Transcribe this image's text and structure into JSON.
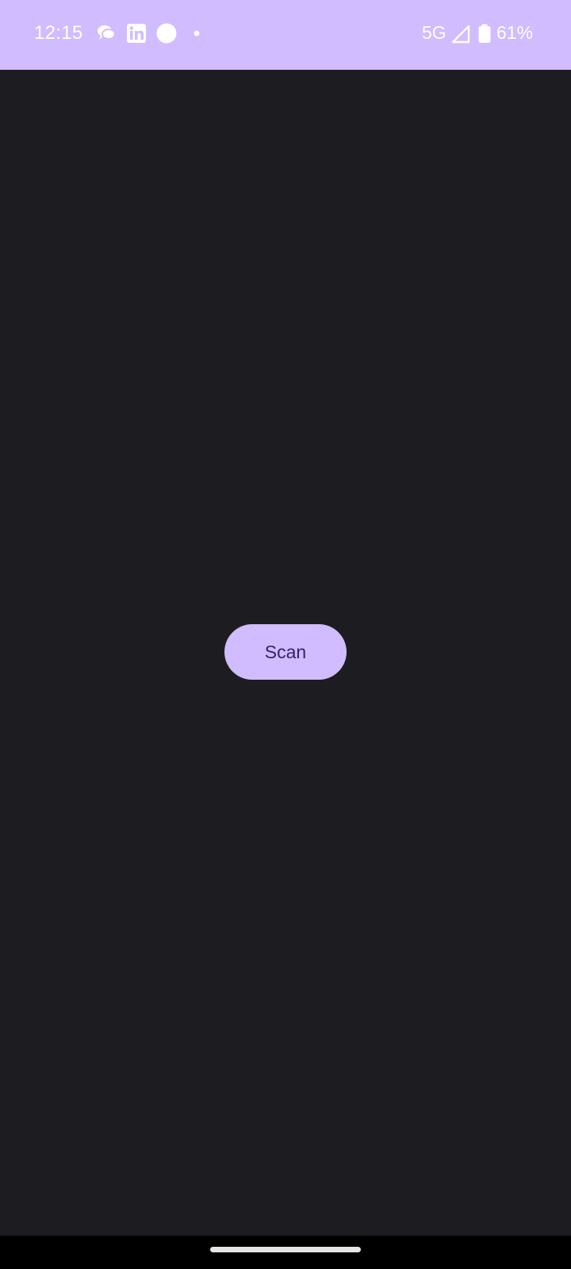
{
  "status_bar": {
    "time": "12:15",
    "left_icons": [
      "chat-bubbles-icon",
      "linkedin-icon",
      "circle-notification-icon",
      "more-notifications-dot-icon"
    ],
    "network": "5G",
    "signal_icon": "cell-signal-icon",
    "battery_icon": "battery-icon",
    "battery_level": "61%",
    "background_color": "#d0bcfe"
  },
  "main": {
    "background_color": "#1d1c20",
    "scan_button": {
      "label": "Scan",
      "background_color": "#d0bcfe",
      "text_color": "#381e72"
    }
  },
  "navigation": {
    "home_handle_icon": "gesture-home-handle"
  }
}
